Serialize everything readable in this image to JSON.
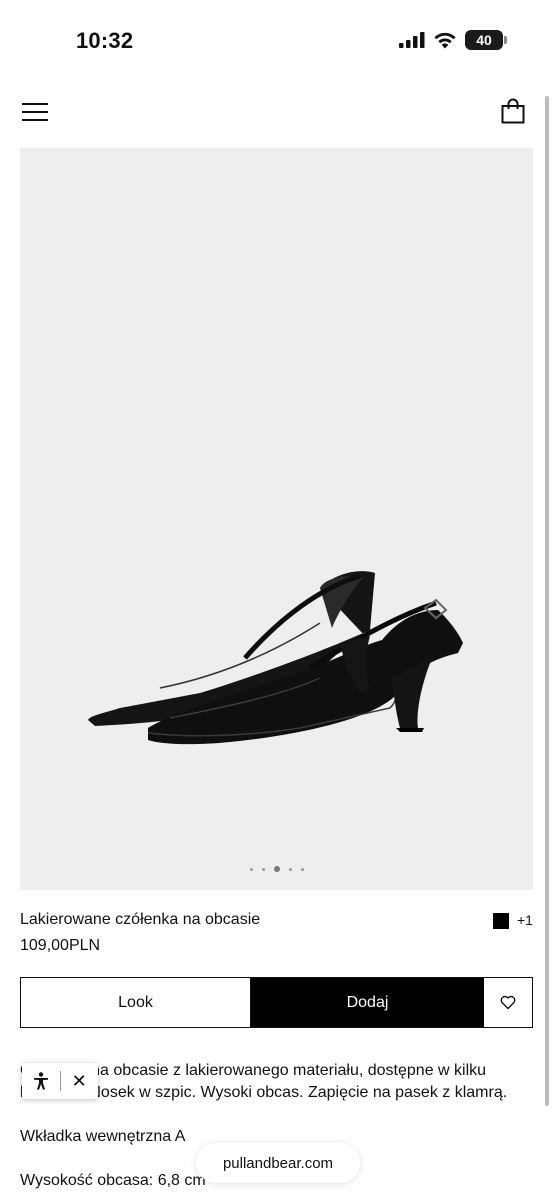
{
  "status_bar": {
    "time": "10:32",
    "battery": "40",
    "icons": [
      "signal-icon",
      "wifi-icon",
      "battery-icon"
    ]
  },
  "header": {
    "icons": [
      "menu-icon",
      "shopping-bag-icon"
    ]
  },
  "product": {
    "image_alt": "black patent slingback pumps",
    "carousel": {
      "total": 5,
      "active_index": 2
    },
    "name": "Lakierowane czółenka na obcasie",
    "price": "109,00PLN",
    "color_swatch": "#000000",
    "more_colors": "+1"
  },
  "actions": {
    "look_label": "Look",
    "add_label": "Dodaj",
    "favorite_icon": "heart-icon"
  },
  "description": {
    "paragraph1": "Czółenka na obcasie z lakierowanego materiału, dostępne w kilku kolorach. Nosek w szpic. Wysoki obcas. Zapięcie na pasek z klamrą.",
    "paragraph2": "Wkładka wewnętrzna A",
    "paragraph3": "Wysokość obcasa: 6,8 cm"
  },
  "accessibility_widget": {
    "icons": [
      "accessibility-icon",
      "close-icon"
    ],
    "close_glyph": "✕"
  },
  "browser": {
    "url": "pullandbear.com"
  }
}
